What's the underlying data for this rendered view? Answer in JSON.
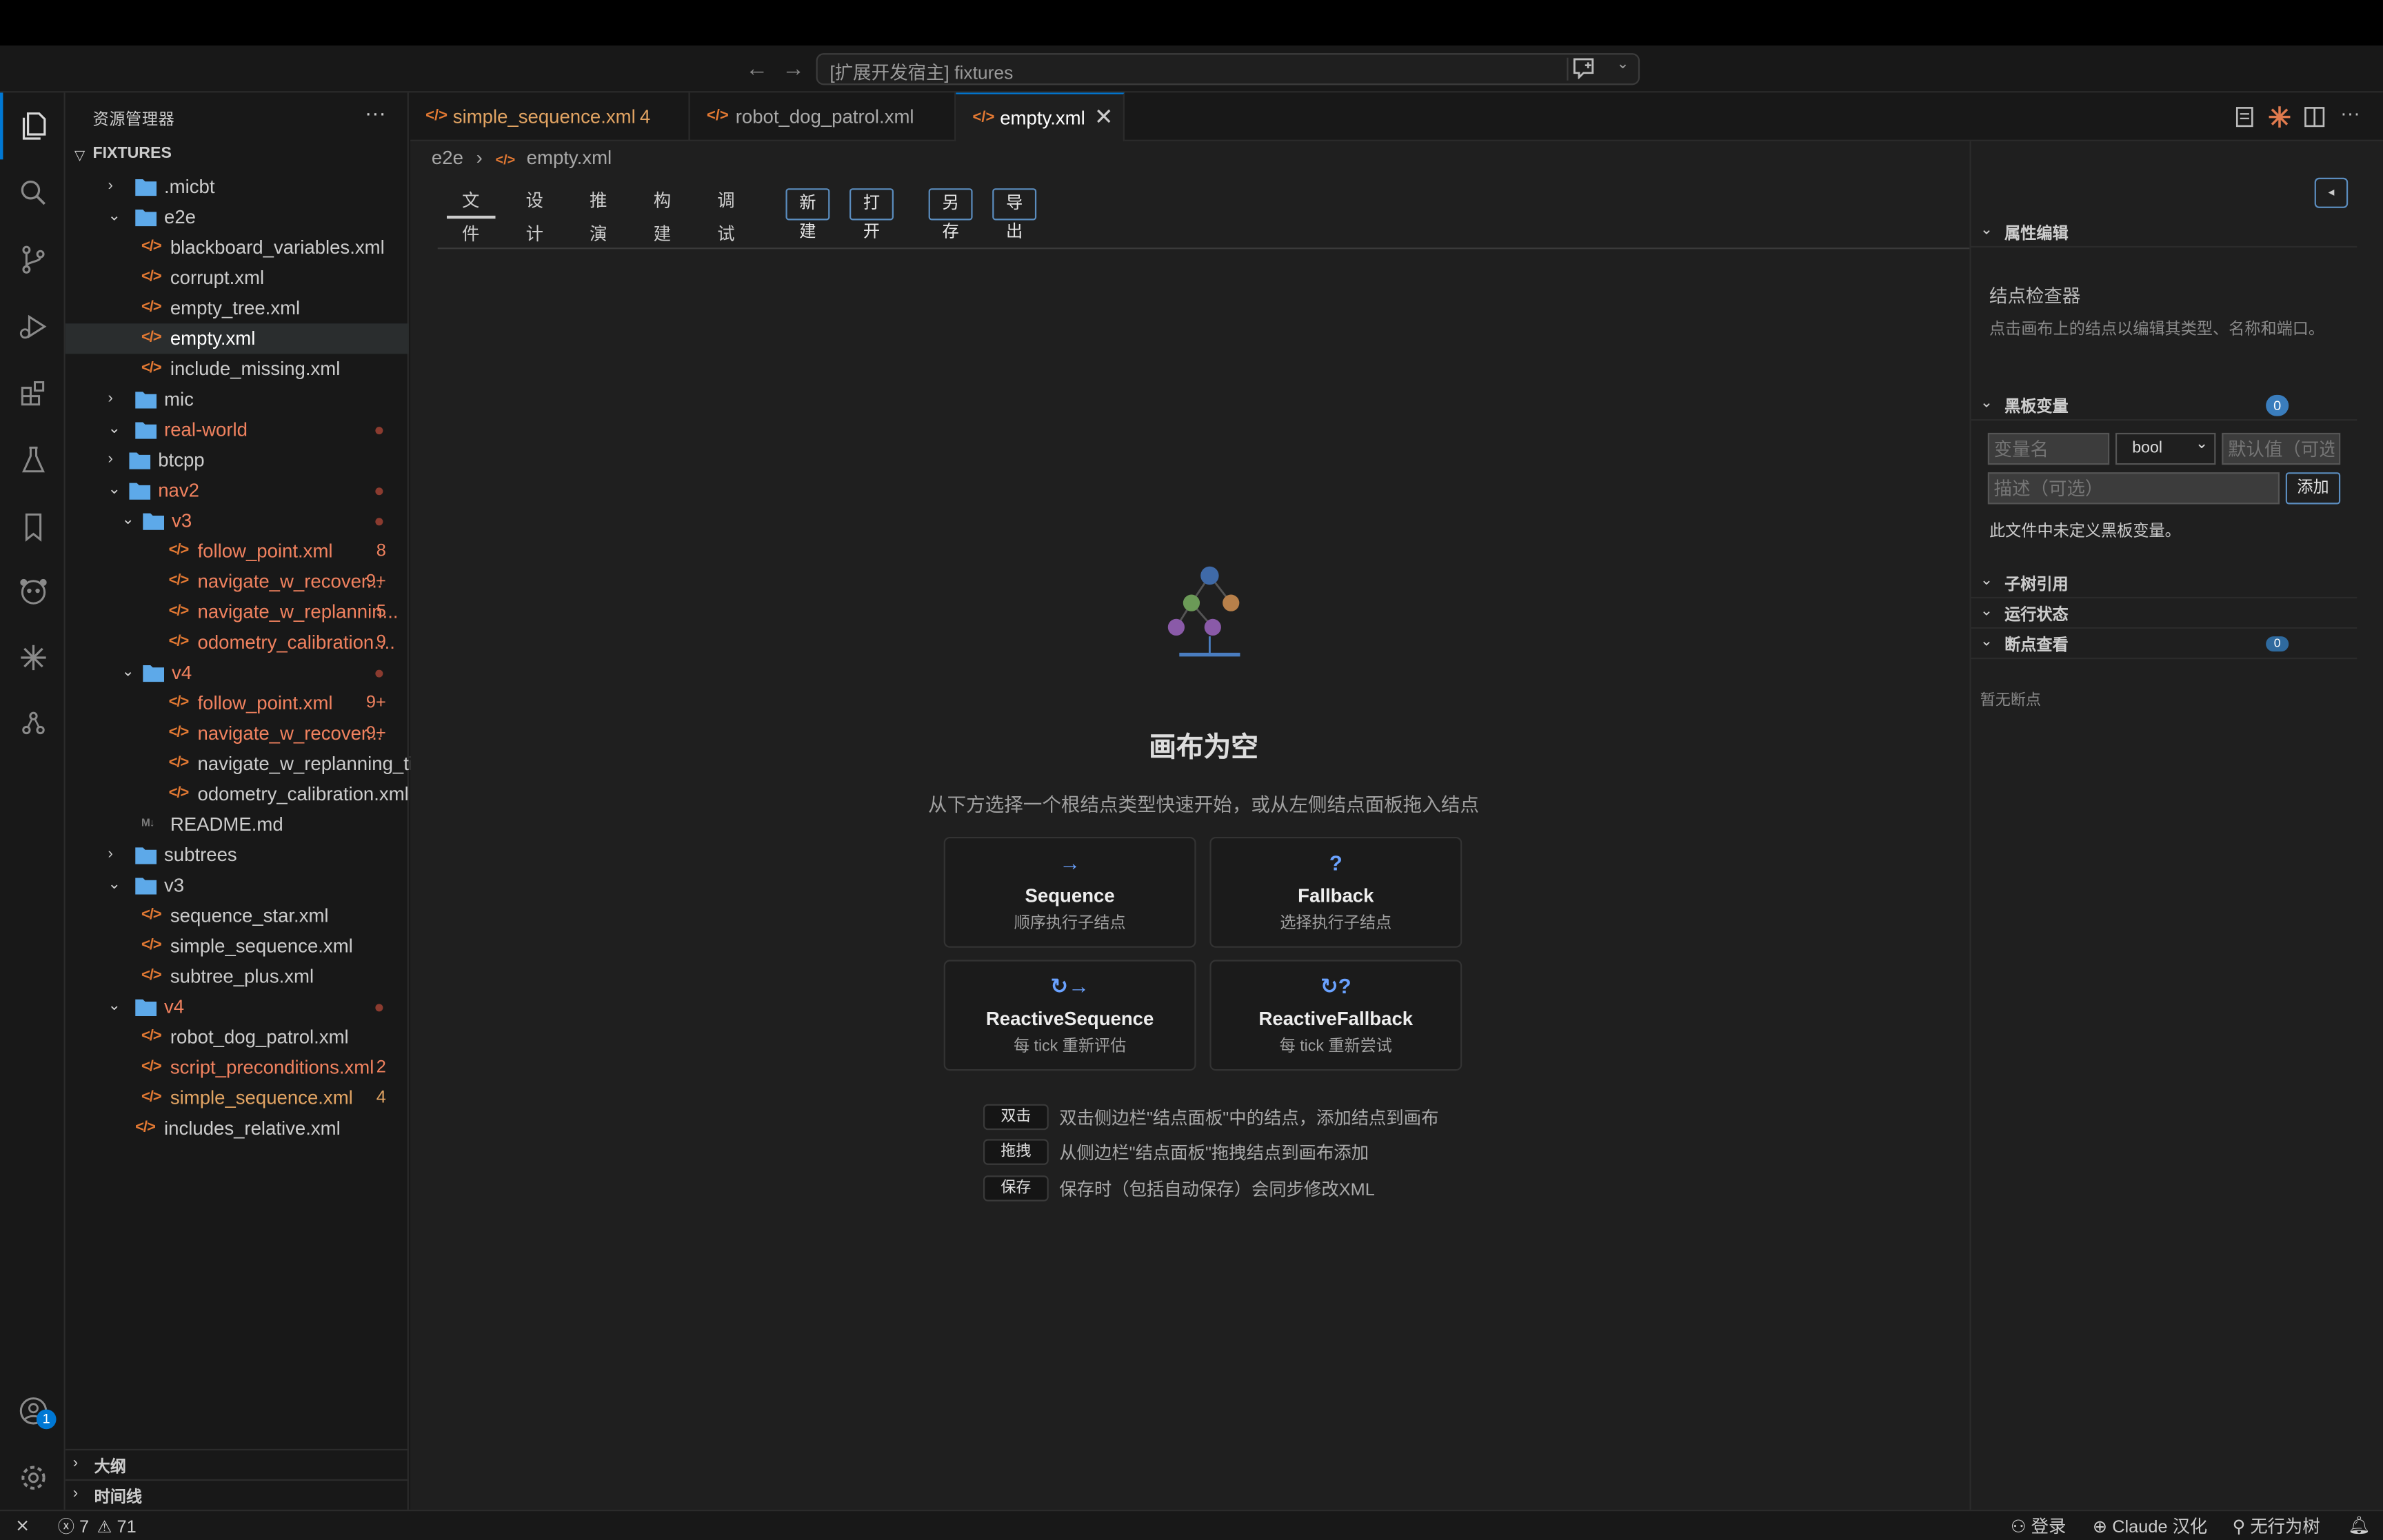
{
  "window": {
    "search_text": "[扩展开发宿主] fixtures"
  },
  "sidebar": {
    "title": "资源管理器",
    "more": "···",
    "section": "FIXTURES",
    "outline": "大纲",
    "timeline": "时间线",
    "tree": [
      {
        "label": ".micbt",
        "kind": "folder",
        "depth": 1,
        "open": false,
        "color": "norm"
      },
      {
        "label": "e2e",
        "kind": "folder",
        "depth": 1,
        "open": true,
        "color": "norm"
      },
      {
        "label": "blackboard_variables.xml",
        "kind": "xml",
        "depth": 2,
        "color": "norm"
      },
      {
        "label": "corrupt.xml",
        "kind": "xml",
        "depth": 2,
        "color": "norm"
      },
      {
        "label": "empty_tree.xml",
        "kind": "xml",
        "depth": 2,
        "color": "norm"
      },
      {
        "label": "empty.xml",
        "kind": "xml",
        "depth": 2,
        "color": "norm",
        "selected": true
      },
      {
        "label": "include_missing.xml",
        "kind": "xml",
        "depth": 2,
        "color": "norm"
      },
      {
        "label": "mic",
        "kind": "folder",
        "depth": 1,
        "open": false,
        "color": "norm"
      },
      {
        "label": "real-world",
        "kind": "folder",
        "depth": 1,
        "open": true,
        "color": "err",
        "dot": true
      },
      {
        "label": "btcpp",
        "kind": "folder",
        "depth": 2,
        "open": false,
        "color": "norm"
      },
      {
        "label": "nav2",
        "kind": "folder",
        "depth": 2,
        "open": true,
        "color": "err",
        "dot": true
      },
      {
        "label": "v3",
        "kind": "folder",
        "depth": 3,
        "open": true,
        "color": "err",
        "dot": true
      },
      {
        "label": "follow_point.xml",
        "kind": "xml",
        "depth": 4,
        "color": "err",
        "badge": "8"
      },
      {
        "label": "navigate_w_recover...",
        "kind": "xml",
        "depth": 4,
        "color": "err",
        "badge": "9+"
      },
      {
        "label": "navigate_w_replannin...",
        "kind": "xml",
        "depth": 4,
        "color": "err",
        "badge": "5"
      },
      {
        "label": "odometry_calibration....",
        "kind": "xml",
        "depth": 4,
        "color": "err",
        "badge": "9"
      },
      {
        "label": "v4",
        "kind": "folder",
        "depth": 3,
        "open": true,
        "color": "err",
        "dot": true
      },
      {
        "label": "follow_point.xml",
        "kind": "xml",
        "depth": 4,
        "color": "err",
        "badge": "9+"
      },
      {
        "label": "navigate_w_recover...",
        "kind": "xml",
        "depth": 4,
        "color": "err",
        "badge": "9+"
      },
      {
        "label": "navigate_w_replanning_ti...",
        "kind": "xml",
        "depth": 4,
        "color": "norm"
      },
      {
        "label": "odometry_calibration.xml",
        "kind": "xml",
        "depth": 4,
        "color": "norm"
      },
      {
        "label": "README.md",
        "kind": "md",
        "depth": 2,
        "color": "norm"
      },
      {
        "label": "subtrees",
        "kind": "folder",
        "depth": 1,
        "open": false,
        "color": "norm"
      },
      {
        "label": "v3",
        "kind": "folder",
        "depth": 1,
        "open": true,
        "color": "norm"
      },
      {
        "label": "sequence_star.xml",
        "kind": "xml",
        "depth": 2,
        "color": "norm"
      },
      {
        "label": "simple_sequence.xml",
        "kind": "xml",
        "depth": 2,
        "color": "norm"
      },
      {
        "label": "subtree_plus.xml",
        "kind": "xml",
        "depth": 2,
        "color": "norm"
      },
      {
        "label": "v4",
        "kind": "folder",
        "depth": 1,
        "open": true,
        "color": "err",
        "dot": true
      },
      {
        "label": "robot_dog_patrol.xml",
        "kind": "xml",
        "depth": 2,
        "color": "norm"
      },
      {
        "label": "script_preconditions.xml",
        "kind": "xml",
        "depth": 2,
        "color": "err",
        "badge": "2"
      },
      {
        "label": "simple_sequence.xml",
        "kind": "xml",
        "depth": 2,
        "color": "mod",
        "badge": "4"
      },
      {
        "label": "includes_relative.xml",
        "kind": "xml",
        "depth": 1,
        "color": "norm"
      }
    ]
  },
  "tabs": [
    {
      "label": "simple_sequence.xml",
      "badge": "4",
      "color": "mod"
    },
    {
      "label": "robot_dog_patrol.xml",
      "badge": "",
      "color": "norm"
    },
    {
      "label": "empty.xml",
      "badge": "",
      "color": "norm",
      "active": true
    }
  ],
  "breadcrumb": {
    "folder": "e2e",
    "file": "empty.xml"
  },
  "menu": {
    "items": [
      "文件",
      "设计",
      "推演",
      "构建",
      "调试"
    ],
    "buttons": [
      "新建",
      "打开",
      "另存",
      "导出"
    ],
    "collapse": "◂"
  },
  "empty_state": {
    "title": "画布为空",
    "subtitle": "从下方选择一个根结点类型快速开始，或从左侧结点面板拖入结点",
    "cards": [
      {
        "glyph": "→",
        "title": "Sequence",
        "desc": "顺序执行子结点"
      },
      {
        "glyph": "?",
        "title": "Fallback",
        "desc": "选择执行子结点"
      },
      {
        "glyph": "↻→",
        "title": "ReactiveSequence",
        "desc": "每 tick 重新评估"
      },
      {
        "glyph": "↻?",
        "title": "ReactiveFallback",
        "desc": "每 tick 重新尝试"
      }
    ],
    "hints": [
      {
        "key": "双击",
        "text": "双击侧边栏\"结点面板\"中的结点，添加结点到画布"
      },
      {
        "key": "拖拽",
        "text": "从侧边栏\"结点面板\"拖拽结点到画布添加"
      },
      {
        "key": "保存",
        "text": "保存时（包括自动保存）会同步修改XML"
      }
    ]
  },
  "right_panel": {
    "properties_title": "属性编辑",
    "inspector_title": "结点检查器",
    "inspector_desc": "点击画布上的结点以编辑其类型、名称和端口。",
    "blackboard_title": "黑板变量",
    "blackboard_count": "0",
    "var_name_placeholder": "变量名",
    "type_value": "bool",
    "default_placeholder": "默认值（可选）",
    "desc_placeholder": "描述（可选）",
    "add_label": "添加",
    "no_vars": "此文件中未定义黑板变量。",
    "subtree_title": "子树引用",
    "runtime_title": "运行状态",
    "breakpoints_title": "断点查看",
    "breakpoints_count": "0",
    "no_breakpoints": "暂无断点"
  },
  "statusbar": {
    "errors": "7",
    "warnings": "71",
    "login": "登录",
    "locale": "Claude 汉化",
    "tree_status": "无行为树"
  },
  "colors": {
    "accent": "#0078d4",
    "modified": "#e2a463",
    "error": "#f1825f",
    "xml_icon": "#e37933",
    "folder": "#5da9e9"
  }
}
